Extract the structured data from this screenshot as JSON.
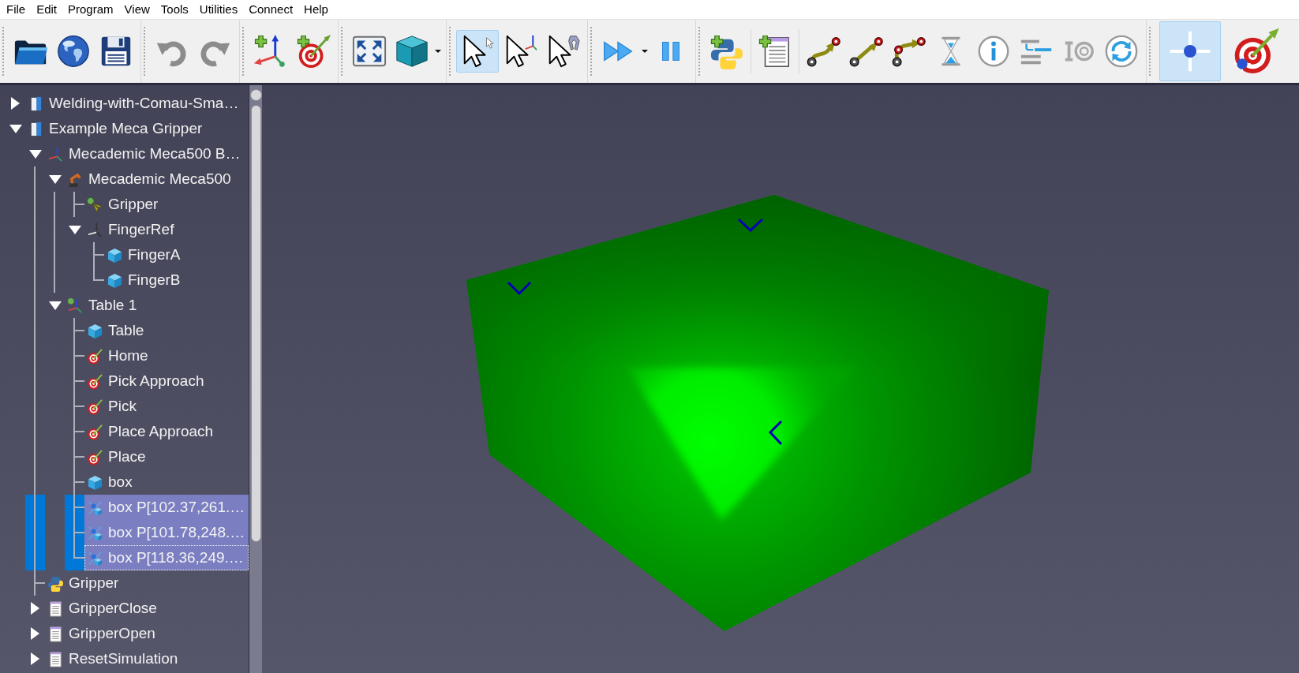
{
  "menu_bar": {
    "items": [
      "File",
      "Edit",
      "Program",
      "View",
      "Tools",
      "Utilities",
      "Connect",
      "Help"
    ]
  },
  "toolbars": [
    {
      "buttons": [
        {
          "kind": "open",
          "selected": false
        },
        {
          "kind": "web",
          "selected": false
        },
        {
          "kind": "save",
          "selected": false
        }
      ]
    },
    {
      "buttons": [
        {
          "kind": "undo",
          "selected": false
        },
        {
          "kind": "redo",
          "selected": false
        }
      ]
    },
    {
      "buttons": [
        {
          "kind": "addframe",
          "selected": false
        },
        {
          "kind": "addtarget",
          "selected": false
        }
      ]
    },
    {
      "buttons": [
        {
          "kind": "fit",
          "selected": false
        },
        {
          "kind": "view",
          "selected": false,
          "dropdown": true
        }
      ]
    },
    {
      "buttons": [
        {
          "kind": "select",
          "selected": true
        },
        {
          "kind": "selectframe",
          "selected": false
        },
        {
          "kind": "selecttool",
          "selected": false
        }
      ]
    },
    {
      "buttons": [
        {
          "kind": "run",
          "selected": false,
          "dropdown": true
        },
        {
          "kind": "pause",
          "selected": false
        }
      ]
    },
    {
      "buttons": [
        {
          "kind": "addpython",
          "selected": false
        },
        {
          "kind": "separator"
        },
        {
          "kind": "addprogram",
          "selected": false
        },
        {
          "kind": "separator"
        },
        {
          "kind": "jointmove",
          "selected": false
        },
        {
          "kind": "linearmove",
          "selected": false
        },
        {
          "kind": "circularmove",
          "selected": false
        },
        {
          "kind": "wait",
          "selected": false
        },
        {
          "kind": "message",
          "selected": false
        },
        {
          "kind": "setref",
          "selected": false
        },
        {
          "kind": "io",
          "selected": false
        },
        {
          "kind": "call",
          "selected": false
        }
      ]
    },
    {
      "buttons": [
        {
          "kind": "targetmode",
          "selected": true
        },
        {
          "kind": "teach",
          "selected": false
        }
      ]
    }
  ],
  "tree": {
    "items": [
      {
        "label": "Welding-with-Comau-Sma…",
        "kind": "station",
        "expanded": false,
        "selected": false,
        "focused": false
      },
      {
        "label": "Example Meca Gripper",
        "kind": "station",
        "expanded": true,
        "selected": false,
        "focused": false,
        "children": [
          {
            "label": "Mecademic Meca500 B…",
            "kind": "frame",
            "expanded": true,
            "selected": false,
            "focused": false,
            "children": [
              {
                "label": "Mecademic Meca500",
                "kind": "robot",
                "expanded": true,
                "selected": false,
                "focused": false,
                "children": [
                  {
                    "label": "Gripper",
                    "kind": "tool",
                    "selected": false,
                    "focused": false
                  },
                  {
                    "label": "FingerRef",
                    "kind": "reference",
                    "expanded": true,
                    "selected": false,
                    "focused": false,
                    "children": [
                      {
                        "label": "FingerA",
                        "kind": "object",
                        "selected": false,
                        "focused": false
                      },
                      {
                        "label": "FingerB",
                        "kind": "object",
                        "selected": false,
                        "focused": false
                      }
                    ]
                  }
                ]
              },
              {
                "label": "Table 1",
                "kind": "activeframe",
                "expanded": true,
                "selected": false,
                "focused": false,
                "children": [
                  {
                    "label": "Table",
                    "kind": "object",
                    "selected": false,
                    "focused": false
                  },
                  {
                    "label": "Home",
                    "kind": "target",
                    "selected": false,
                    "focused": false
                  },
                  {
                    "label": "Pick Approach",
                    "kind": "target",
                    "selected": false,
                    "focused": false
                  },
                  {
                    "label": "Pick",
                    "kind": "target",
                    "selected": false,
                    "focused": false
                  },
                  {
                    "label": "Place Approach",
                    "kind": "target",
                    "selected": false,
                    "focused": false
                  },
                  {
                    "label": "Place",
                    "kind": "target",
                    "selected": false,
                    "focused": false
                  },
                  {
                    "label": "box",
                    "kind": "object",
                    "selected": false,
                    "focused": false
                  },
                  {
                    "label": "box P[102.37,261.…",
                    "kind": "point",
                    "selected": true,
                    "focused": false
                  },
                  {
                    "label": "box P[101.78,248.…",
                    "kind": "point",
                    "selected": true,
                    "focused": false
                  },
                  {
                    "label": "box P[118.36,249.…",
                    "kind": "point",
                    "selected": true,
                    "focused": true
                  }
                ]
              }
            ]
          },
          {
            "label": "Gripper",
            "kind": "script",
            "selected": false,
            "focused": false
          },
          {
            "label": "GripperClose",
            "kind": "program",
            "expanded": false,
            "selected": false,
            "focused": false
          },
          {
            "label": "GripperOpen",
            "kind": "program",
            "expanded": false,
            "selected": false,
            "focused": false
          },
          {
            "label": "ResetSimulation",
            "kind": "program",
            "expanded": false,
            "selected": false,
            "focused": false
          }
        ]
      }
    ]
  }
}
